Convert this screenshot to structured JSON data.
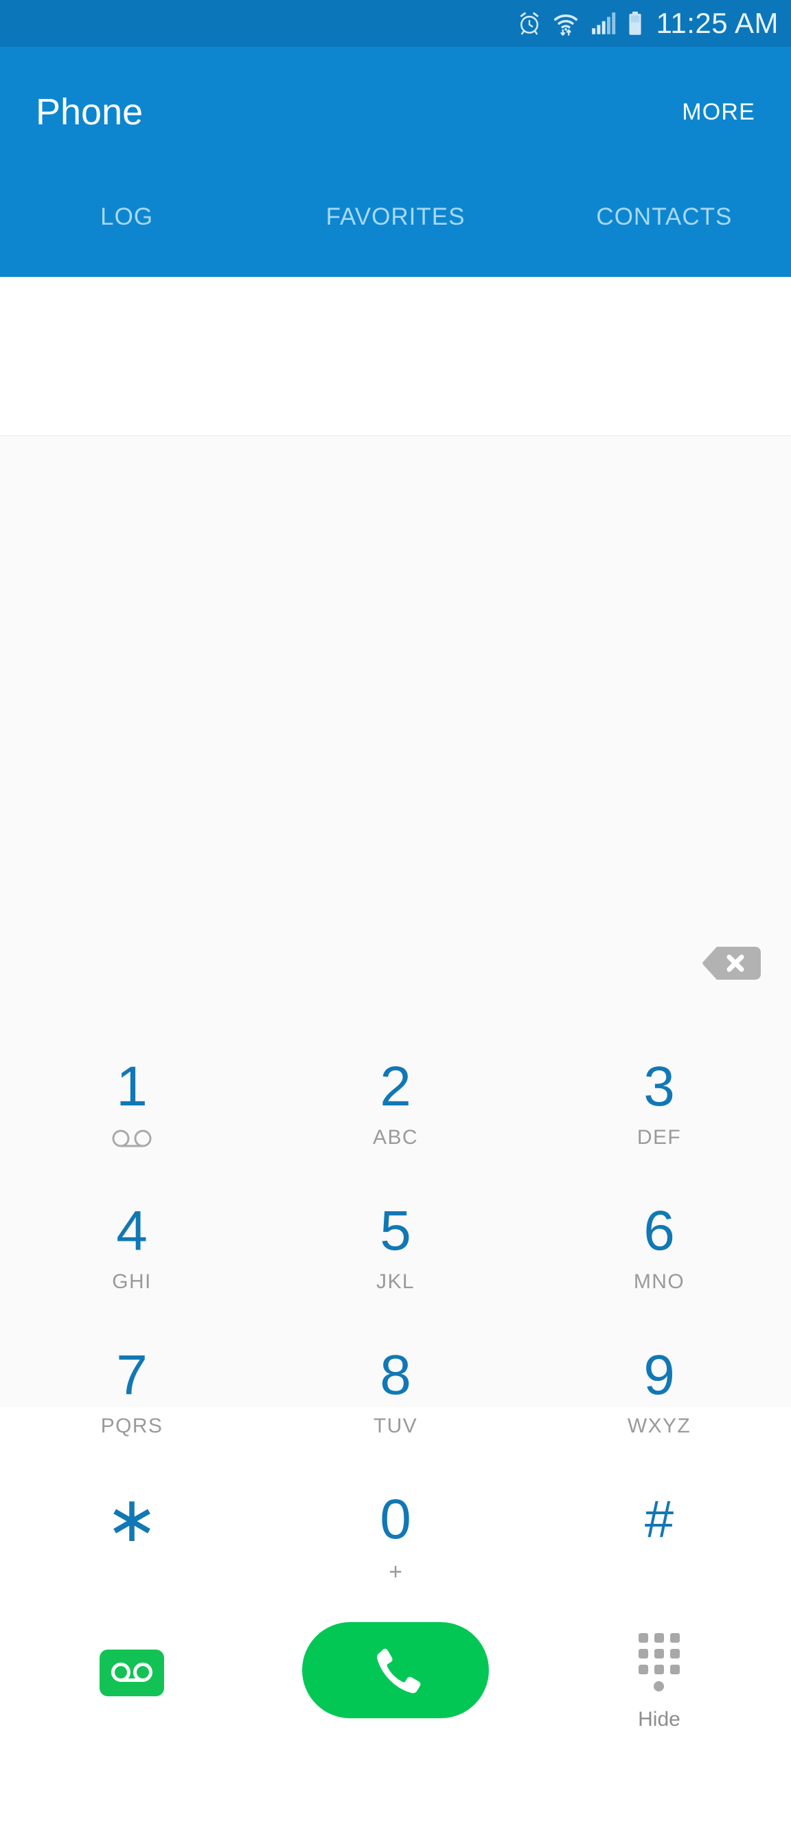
{
  "status_bar": {
    "time": "11:25 AM",
    "icons": [
      "alarm-icon",
      "wifi-icon",
      "signal-icon",
      "battery-icon"
    ],
    "background_color": "#0c76ba"
  },
  "app_bar": {
    "title": "Phone",
    "more_label": "MORE",
    "background_color": "#0d86cf",
    "tabs": [
      {
        "label": "LOG",
        "active": false
      },
      {
        "label": "FAVORITES",
        "active": false
      },
      {
        "label": "CONTACTS",
        "active": false
      }
    ]
  },
  "number_display": {
    "value": "",
    "placeholder": ""
  },
  "dialpad": {
    "backspace_label": "backspace",
    "accent_color": "#1178b5",
    "letters_color": "#9a9a9a",
    "keys": [
      {
        "digit": "1",
        "letters": "",
        "sub_icon": "voicemail-icon"
      },
      {
        "digit": "2",
        "letters": "ABC",
        "sub_icon": ""
      },
      {
        "digit": "3",
        "letters": "DEF",
        "sub_icon": ""
      },
      {
        "digit": "4",
        "letters": "GHI",
        "sub_icon": ""
      },
      {
        "digit": "5",
        "letters": "JKL",
        "sub_icon": ""
      },
      {
        "digit": "6",
        "letters": "MNO",
        "sub_icon": ""
      },
      {
        "digit": "7",
        "letters": "PQRS",
        "sub_icon": ""
      },
      {
        "digit": "8",
        "letters": "TUV",
        "sub_icon": ""
      },
      {
        "digit": "9",
        "letters": "WXYZ",
        "sub_icon": ""
      },
      {
        "digit": "∗",
        "letters": "",
        "sub_icon": ""
      },
      {
        "digit": "0",
        "letters": "+",
        "sub_icon": ""
      },
      {
        "digit": "#",
        "letters": "",
        "sub_icon": ""
      }
    ]
  },
  "actions": {
    "voicemail": {
      "icon": "voicemail-icon",
      "color": "#13c254"
    },
    "call": {
      "icon": "phone-handset-icon",
      "color": "#03c755"
    },
    "hide": {
      "icon": "keypad-grid-icon",
      "label": "Hide"
    }
  }
}
